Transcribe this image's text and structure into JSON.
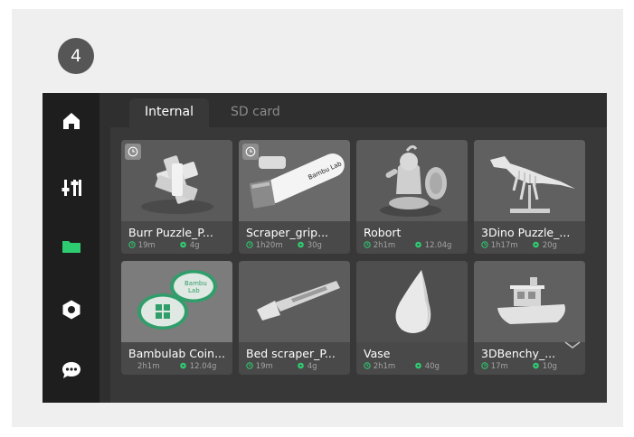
{
  "step_badge": "4",
  "colors": {
    "accent": "#2ecc71",
    "screen_bg": "#2f2f2f",
    "sidebar_bg": "#1e1e1e",
    "card_bg": "#494949"
  },
  "sidebar": {
    "items": [
      {
        "icon": "home-icon",
        "active": false
      },
      {
        "icon": "sliders-icon",
        "active": false
      },
      {
        "icon": "folder-icon",
        "active": true
      },
      {
        "icon": "gear-icon",
        "active": false
      },
      {
        "icon": "chat-icon",
        "active": false
      }
    ]
  },
  "tabs": [
    {
      "label": "Internal",
      "active": true
    },
    {
      "label": "SD card",
      "active": false
    }
  ],
  "files": [
    {
      "name": "Burr Puzzle_P...",
      "time": "19m",
      "weight": "4g",
      "history_icon": true
    },
    {
      "name": "Scraper_grip...",
      "time": "1h20m",
      "weight": "30g",
      "history_icon": true
    },
    {
      "name": "Robort",
      "time": "2h1m",
      "weight": "12.04g",
      "history_icon": false
    },
    {
      "name": "3Dino Puzzle_...",
      "time": "1h17m",
      "weight": "20g",
      "history_icon": false
    },
    {
      "name": "Bambulab Coin...",
      "time": "2h1m",
      "weight": "12.04g",
      "history_icon": false
    },
    {
      "name": "Bed scraper_P...",
      "time": "19m",
      "weight": "4g",
      "history_icon": false
    },
    {
      "name": "Vase",
      "time": "2h1m",
      "weight": "40g",
      "history_icon": false
    },
    {
      "name": "3DBenchy_...",
      "time": "17m",
      "weight": "10g",
      "history_icon": false
    }
  ],
  "thumb_labels": {
    "scraper_brand": "Bambu Lab",
    "coin_text_1": "Bambu",
    "coin_text_2": "Lab"
  }
}
